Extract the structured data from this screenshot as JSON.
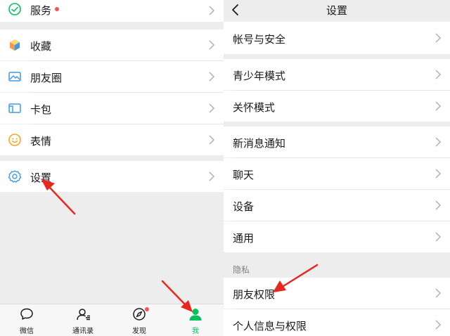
{
  "left_panel": {
    "menu": [
      {
        "label": "服务",
        "icon": "service-icon",
        "has_dot": true
      },
      {
        "label": "收藏",
        "icon": "favorites-icon"
      },
      {
        "label": "朋友圈",
        "icon": "moments-icon"
      },
      {
        "label": "卡包",
        "icon": "card-wallet-icon"
      },
      {
        "label": "表情",
        "icon": "sticker-icon"
      },
      {
        "label": "设置",
        "icon": "gear-icon"
      }
    ],
    "tabbar": [
      {
        "label": "微信",
        "icon": "chat-icon",
        "active": false
      },
      {
        "label": "通讯录",
        "icon": "contacts-icon",
        "active": false
      },
      {
        "label": "发现",
        "icon": "discover-icon",
        "active": false,
        "has_dot": true
      },
      {
        "label": "我",
        "icon": "me-icon",
        "active": true
      }
    ]
  },
  "right_panel": {
    "back_icon": "chevron-left-icon",
    "title": "设置",
    "items": [
      {
        "label": "帐号与安全"
      },
      {
        "label": "青少年模式"
      },
      {
        "label": "关怀模式"
      },
      {
        "label": "新消息通知"
      },
      {
        "label": "聊天"
      },
      {
        "label": "设备"
      },
      {
        "label": "通用"
      },
      {
        "label": "朋友权限"
      },
      {
        "label": "个人信息与权限"
      }
    ],
    "privacy_section_label": "隐私"
  },
  "colors": {
    "accent_green": "#07c160",
    "badge_red": "#fa5151",
    "annotation_arrow": "#e8281f",
    "background_gray": "#ededed"
  }
}
